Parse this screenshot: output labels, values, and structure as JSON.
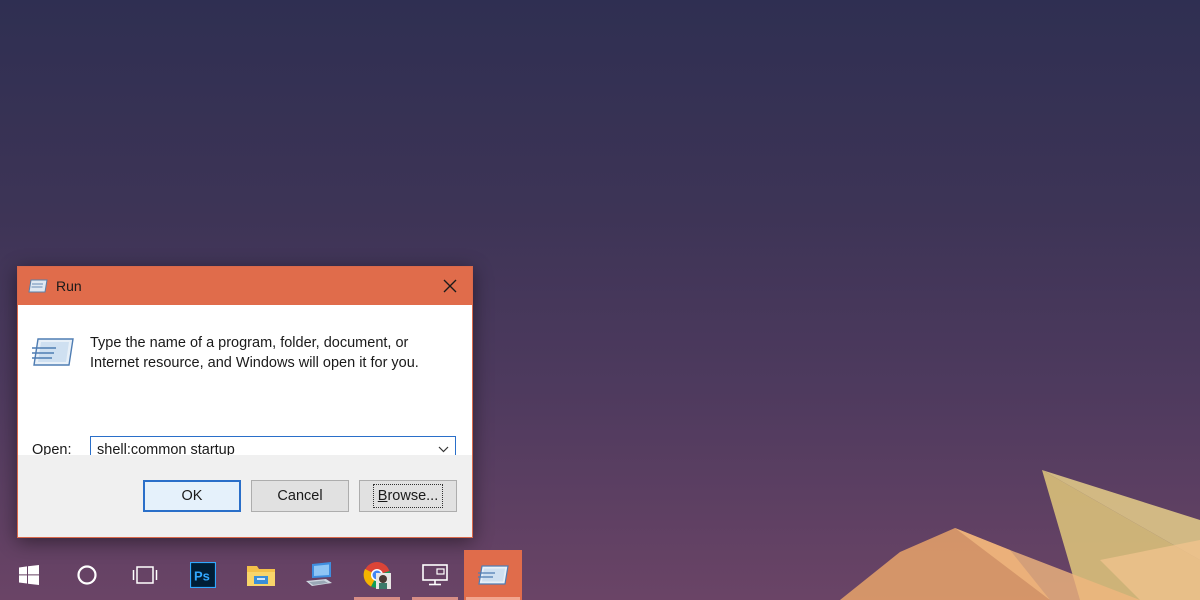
{
  "dialog": {
    "title": "Run",
    "description": "Type the name of a program, folder, document, or Internet resource, and Windows will open it for you.",
    "open_label_accel": "O",
    "open_label_rest": "pen:",
    "open_value": "shell:common startup",
    "buttons": {
      "ok": "OK",
      "cancel": "Cancel",
      "browse_accel": "B",
      "browse_rest": "rowse..."
    }
  },
  "taskbar": {
    "items": [
      {
        "icon": "windows-start-icon"
      },
      {
        "icon": "cortana-search-icon"
      },
      {
        "icon": "task-view-icon"
      },
      {
        "icon": "photoshop-icon",
        "label": "Ps"
      },
      {
        "icon": "file-explorer-icon"
      },
      {
        "icon": "computer-icon"
      },
      {
        "icon": "chrome-icon"
      },
      {
        "icon": "remote-desktop-icon"
      },
      {
        "icon": "run-app-icon"
      }
    ]
  },
  "colors": {
    "accent": "#e06c4b",
    "focus_blue": "#2a6fc9",
    "photoshop_bg": "#001e36",
    "photoshop_fg": "#31a8ff"
  }
}
